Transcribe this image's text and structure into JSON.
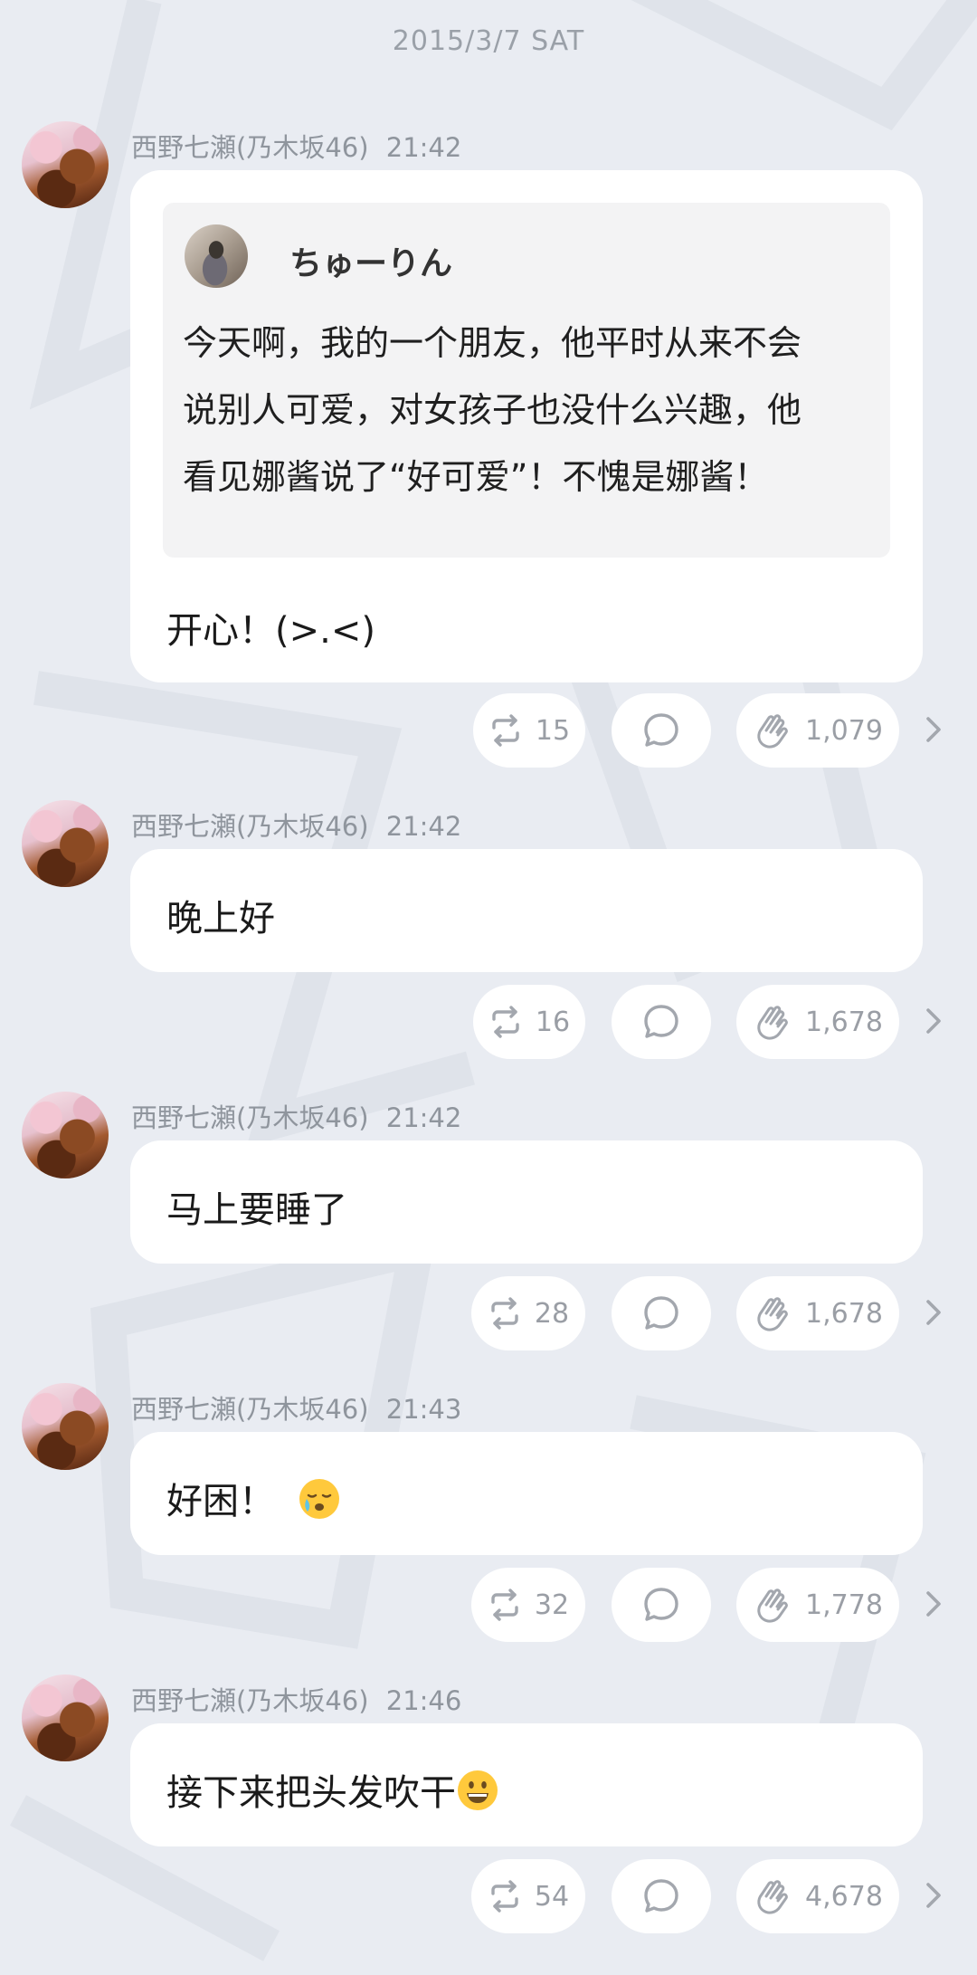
{
  "date_header": "2015/3/7 SAT",
  "author": "西野七瀬(乃木坂46)",
  "posts": [
    {
      "time": "21:42",
      "quote": {
        "name": "ちゅーりん",
        "lines": [
          "今天啊，我的一个朋友，他平时从来不会",
          "说别人可爱，对女孩子也没什么兴趣，他",
          "看见娜酱说了“好可爱”！不愧是娜酱！"
        ]
      },
      "text": "开心！(>.<)",
      "reposts": "15",
      "claps": "1,079"
    },
    {
      "time": "21:42",
      "text": "晚上好",
      "reposts": "16",
      "claps": "1,678"
    },
    {
      "time": "21:42",
      "text": "马上要睡了",
      "reposts": "28",
      "claps": "1,678"
    },
    {
      "time": "21:43",
      "text": "好困！",
      "emoji": "sleepy-face-emoji",
      "reposts": "32",
      "claps": "1,778"
    },
    {
      "time": "21:46",
      "text": "接下来把头发吹干",
      "emoji": "grinning-face-emoji",
      "reposts": "54",
      "claps": "4,678"
    }
  ],
  "icons": {
    "repost": "repost-icon",
    "comment": "comment-icon",
    "clap": "clap-icon",
    "more": "chevron-right-icon"
  },
  "colors": {
    "background": "#e9ecf2",
    "bubble": "#ffffff",
    "meta_text": "#8f959d",
    "action_text": "#9a9ea5"
  }
}
